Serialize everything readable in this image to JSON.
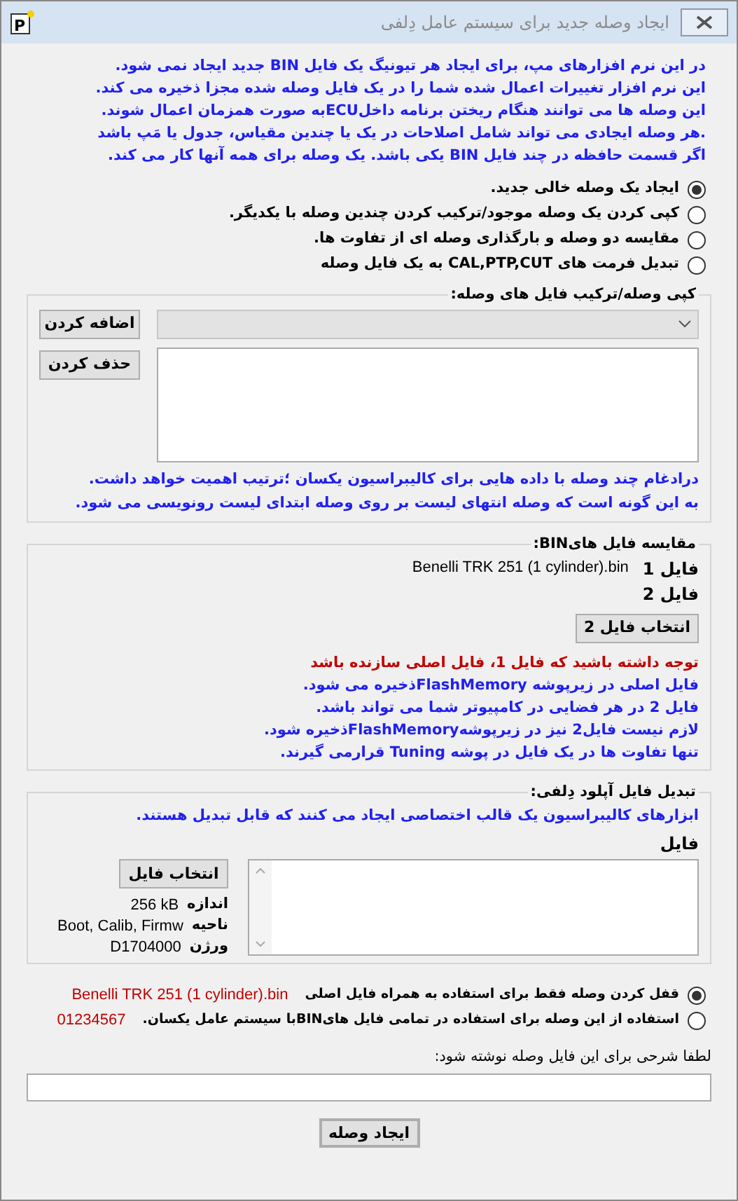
{
  "window": {
    "title": "ایجاد وصله جدید برای سیستم عامل دِلفی",
    "icon_letter": "P"
  },
  "intro": [
    "در این نرم افزارهای مپ،  برای ایجاد  هر تیونیگ یک فایل BIN جدید ایجاد نمی شود.",
    "این نرم افزار تغییرات اعمال شده شما را در یک فایل وصله شده مجزا  ذخیره می کند.",
    "این وصله ها می توانند هنگام ریختن برنامه داخلECUبه صورت همزمان اعمال شوند.",
    ".هر وصله ایجادی می تواند شامل اصلاحات در یک یا چندین مقیاس، جدول یا مَپ باشد",
    "اگر  قسمت حافظه در چند فایل BIN یکی باشد. یک وصله برای همه آنها کار می کند."
  ],
  "mode_options": [
    {
      "label": "ایجاد یک وصله خالی جدید.",
      "selected": true
    },
    {
      "label": "کپی کردن یک وصله موجود/ترکیب کردن چندین وصله با یکدیگر.",
      "selected": false
    },
    {
      "label": "مقایسه دو وصله و بارگذاری وصله ای از تفاوت ها.",
      "selected": false
    },
    {
      "label": "تبدیل فرمت های CAL,PTP,CUT به یک فایل وصله",
      "selected": false
    }
  ],
  "copy_group": {
    "title": "کپی وصله/ترکیب فایل های وصله:",
    "dropdown": {
      "disabled": true
    },
    "buttons": [
      "اضافه کردن",
      "حذف کردن"
    ],
    "notes": [
      "درادغام چند وصله با داده هایی برای  کالیبراسیون یکسان ؛ترتیب اهمیت خواهد داشت.",
      "به این گونه است که وصله انتهای لیست بر روی وصله ابتدای لیست رونویسی می شود."
    ]
  },
  "compare_group": {
    "title": "مقایسه فایل هایBIN:",
    "files": [
      {
        "label": "فایل 1",
        "value": "Benelli TRK 251 (1 cylinder).bin"
      },
      {
        "label": "فایل 2"
      }
    ],
    "button": "انتخاب فایل 2",
    "warning": "توجه داشته باشید که فایل 1، فایل اصلی سازنده باشد",
    "notes": [
      "فایل اصلی در زیرپوشه FlashMemoryذخیره می شود.",
      "فایل 2 در هر فضایی در کامپیوتر شما می تواند باشد.",
      "لازم نیست فایل2 نیز در زیرپوشهFlashMemoryذخیره شود.",
      "تنها تفاوت ها در یک فایل در  پوشه Tuning قرارمی گیرند."
    ]
  },
  "convert_group": {
    "title": "تبدیل فایل آپلود دِلفی:",
    "note": "ابزارهای کالیبراسیون یک قالب اختصاصی ایجاد می کنند که  قابل تبدیل هستند.",
    "file_label": "فایل",
    "button": "انتخاب فایل",
    "info": [
      {
        "label": "اندازه",
        "value": "256 kB"
      },
      {
        "label": "ناحیه",
        "value": "Boot, Calib, Firmw"
      },
      {
        "label": "ورژن",
        "value": "D1704000"
      }
    ]
  },
  "lock_options": [
    {
      "label": "قفل کردن وصله فقط برای استفاده به همراه فایل اصلی",
      "detail": "Benelli TRK 251 (1 cylinder).bin",
      "selected": true
    },
    {
      "label": "استفاده از این وصله برای استفاده در تمامی فایل هایBINبا سیستم عامل یکسان.",
      "detail": "01234567",
      "selected": false
    }
  ],
  "description": {
    "label": "لطفا شرحی برای این فایل وصله نوشته شود:"
  },
  "create_button": "ایجاد وصله"
}
